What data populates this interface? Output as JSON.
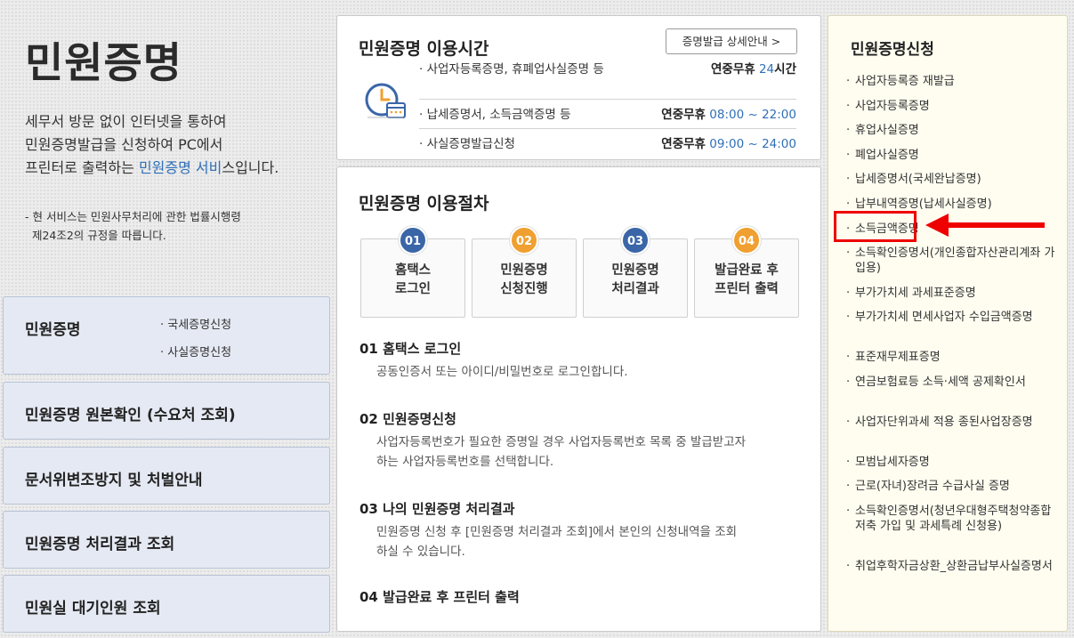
{
  "intro": {
    "title": "민원증명",
    "desc_line1": "세무서 방문 없이 인터넷을 통하여",
    "desc_line2": "민원증명발급을 신청하여 PC에서",
    "desc_line3_pre": "프린터로 출력하는 ",
    "desc_line3_hl": "민원증명 서비",
    "desc_line3_post": "스입니다.",
    "note_line1": "- 현 서비스는 민원사무처리에 관한 법률시행령",
    "note_line2": "  제24조2의 규정을 따릅니다."
  },
  "left_menu": {
    "item1": {
      "title": "민원증명",
      "sub1": "· 국세증명신청",
      "sub2": "· 사실증명신청"
    },
    "item2": "민원증명 원본확인 (수요처 조회)",
    "item3": "문서위변조방지 및 처벌안내",
    "item4": "민원증명 처리결과 조회",
    "item5": "민원실 대기인원 조회"
  },
  "hours": {
    "title": "민원증명 이용시간",
    "detail_button": "증명발급 상세안내 >",
    "rows": [
      {
        "label": "· 사업자등록증명, 휴폐업사실증명 등",
        "day": "연중무휴",
        "time": "24",
        "unit": "시간"
      },
      {
        "label": "· 납세증명서, 소득금액증명 등",
        "day": "연중무휴",
        "time": "08:00 ~ 22:00",
        "unit": ""
      },
      {
        "label": "· 사실증명발급신청",
        "day": "연중무휴",
        "time": "09:00 ~ 24:00",
        "unit": ""
      }
    ]
  },
  "procedure": {
    "title": "민원증명 이용절차",
    "steps": [
      {
        "num": "01",
        "line1": "홈택스",
        "line2": "로그인"
      },
      {
        "num": "02",
        "line1": "민원증명",
        "line2": "신청진행"
      },
      {
        "num": "03",
        "line1": "민원증명",
        "line2": "처리결과"
      },
      {
        "num": "04",
        "line1": "발급완료 후",
        "line2": "프린터 출력"
      }
    ],
    "sections": [
      {
        "heading": "01 홈택스 로그인",
        "body1": "공동인증서 또는 아이디/비밀번호로 로그인합니다.",
        "body2": ""
      },
      {
        "heading": "02 민원증명신청",
        "body1": "사업자등록번호가 필요한 증명일 경우 사업자등록번호 목록 중 발급받고자",
        "body2": "하는 사업자등록번호를 선택합니다."
      },
      {
        "heading": "03 나의 민원증명 처리결과",
        "body1": "민원증명 신청 후 [민원증명 처리결과 조회]에서 본인의 신청내역을 조회",
        "body2": "하실 수 있습니다."
      },
      {
        "heading": "04 발급완료 후 프린터 출력",
        "body1": "",
        "body2": ""
      }
    ]
  },
  "apply": {
    "title": "민원증명신청",
    "items": [
      "사업자등록증 재발급",
      "사업자등록증명",
      "휴업사실증명",
      "폐업사실증명",
      "납세증명서(국세완납증명)",
      "납부내역증명(납세사실증명)",
      "소득금액증명",
      "소득확인증명서(개인종합자산관리계좌 가입용)",
      "부가가치세 과세표준증명",
      "부가가치세 면세사업자 수입금액증명",
      "표준재무제표증명",
      "연금보험료등 소득·세액 공제확인서",
      "사업자단위과세 적용 종된사업장증명",
      "모범납세자증명",
      "근로(자녀)장려금 수급사실 증명",
      "소득확인증명서(청년우대형주택청약종합저축 가입 및 과세특례 신청용)",
      "취업후학자금상환_상환금납부사실증명서"
    ],
    "bullet": "·",
    "highlighted_index": 6
  },
  "colors": {
    "step_blue": "#3a66a8",
    "step_orange": "#f0a030",
    "accent_blue": "#2f6fb8",
    "highlight_red": "#ee0000"
  }
}
